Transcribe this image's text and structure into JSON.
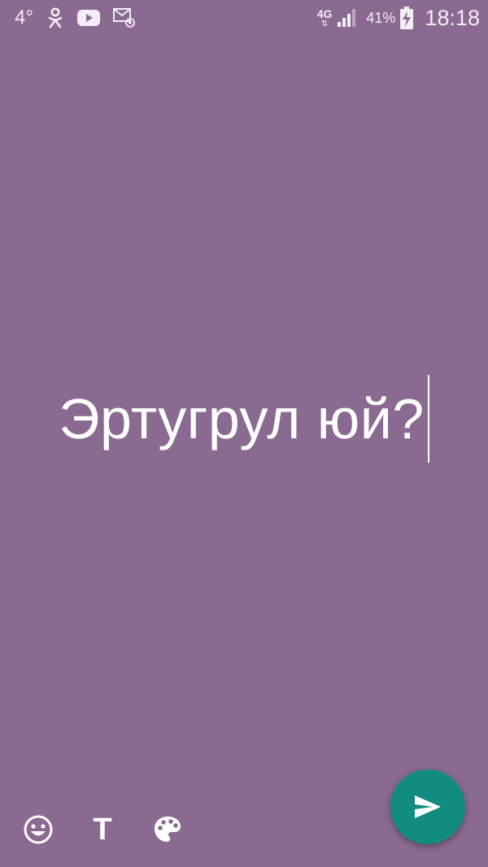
{
  "colors": {
    "background": "#8a6a90",
    "fab": "#128c7e",
    "text": "#ffffff"
  },
  "status_bar": {
    "temperature": "4°",
    "network_type": "4G",
    "battery_percent": "41%",
    "time": "18:18",
    "icons": [
      "odnoklassniki-icon",
      "youtube-icon",
      "email-notification-icon",
      "signal-icon",
      "battery-charging-icon"
    ]
  },
  "composer": {
    "text": "Эртугрул юй?"
  },
  "toolbar": {
    "emoji_icon": "emoji-icon",
    "text_style_glyph": "T",
    "palette_icon": "palette-icon"
  },
  "send_button": {
    "icon": "send-icon"
  }
}
